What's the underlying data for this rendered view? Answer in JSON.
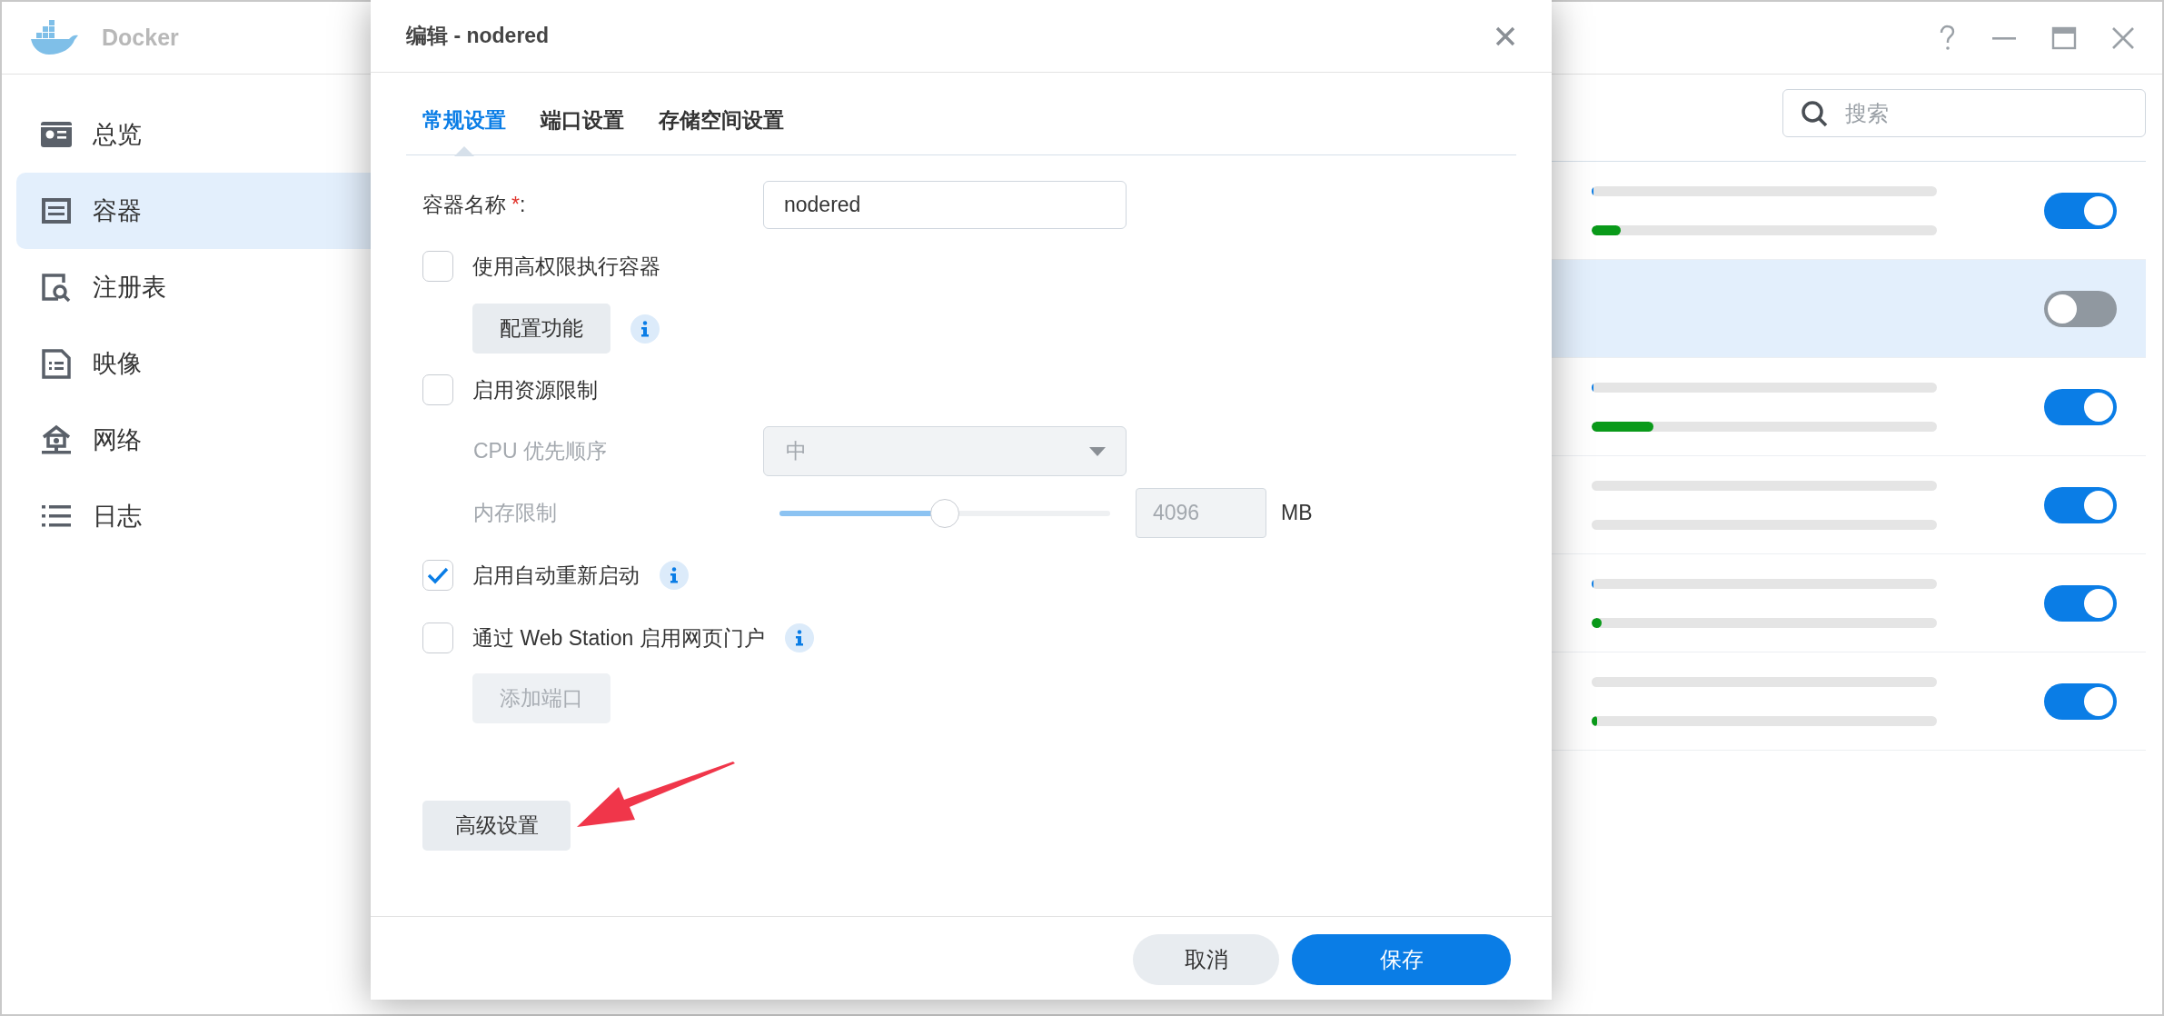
{
  "app": {
    "title": "Docker"
  },
  "sidebar": {
    "items": [
      {
        "label": "总览",
        "selected": false
      },
      {
        "label": "容器",
        "selected": true
      },
      {
        "label": "注册表",
        "selected": false
      },
      {
        "label": "映像",
        "selected": false
      },
      {
        "label": "网络",
        "selected": false
      },
      {
        "label": "日志",
        "selected": false
      }
    ]
  },
  "search": {
    "placeholder": "搜索"
  },
  "containers": [
    {
      "selected": false,
      "running": true,
      "usage": [
        {
          "kind": "cpu",
          "level": 0.005
        },
        {
          "kind": "memory",
          "level": 0.085
        }
      ]
    },
    {
      "selected": true,
      "running": false
    },
    {
      "selected": false,
      "running": true,
      "usage": [
        {
          "kind": "cpu",
          "level": 0.005
        },
        {
          "kind": "memory",
          "level": 0.18
        }
      ]
    },
    {
      "selected": false,
      "running": true,
      "usage": [
        {
          "kind": "cpu"
        },
        {
          "kind": "memory"
        }
      ]
    },
    {
      "selected": false,
      "running": true,
      "usage": [
        {
          "kind": "cpu",
          "level": 0.005
        },
        {
          "kind": "memory",
          "level": 0.03
        }
      ]
    },
    {
      "selected": false,
      "running": true,
      "usage": [
        {
          "kind": "cpu"
        },
        {
          "kind": "memory",
          "level": 0.015
        }
      ]
    }
  ],
  "dialog": {
    "title": "编辑 - nodered",
    "tabs": [
      {
        "label": "常规设置",
        "selected": true
      },
      {
        "label": "端口设置",
        "selected": false
      },
      {
        "label": "存储空间设置",
        "selected": false
      }
    ],
    "name_field": {
      "label": "容器名称",
      "required_mark": "*",
      "colon": ":",
      "value": "nodered"
    },
    "privileged": {
      "label": "使用高权限执行容器",
      "checked": false,
      "button": {
        "label": "配置功能",
        "disabled": false
      }
    },
    "resource_limit": {
      "label": "启用资源限制",
      "checked": false,
      "cpu_priority": {
        "label": "CPU 优先顺序",
        "value": "中",
        "disabled": true
      },
      "memory_limit": {
        "label": "内存限制",
        "level": 0.5,
        "value": "4096",
        "unit": "MB",
        "disabled": true
      }
    },
    "auto_restart": {
      "label": "启用自动重新启动",
      "checked": true
    },
    "web_portal": {
      "label": "通过 Web Station 启用网页门户",
      "checked": false,
      "button": {
        "label": "添加端口",
        "disabled": true
      }
    },
    "advanced_button": "高级设置",
    "footer": {
      "cancel": "取消",
      "save": "保存"
    }
  }
}
